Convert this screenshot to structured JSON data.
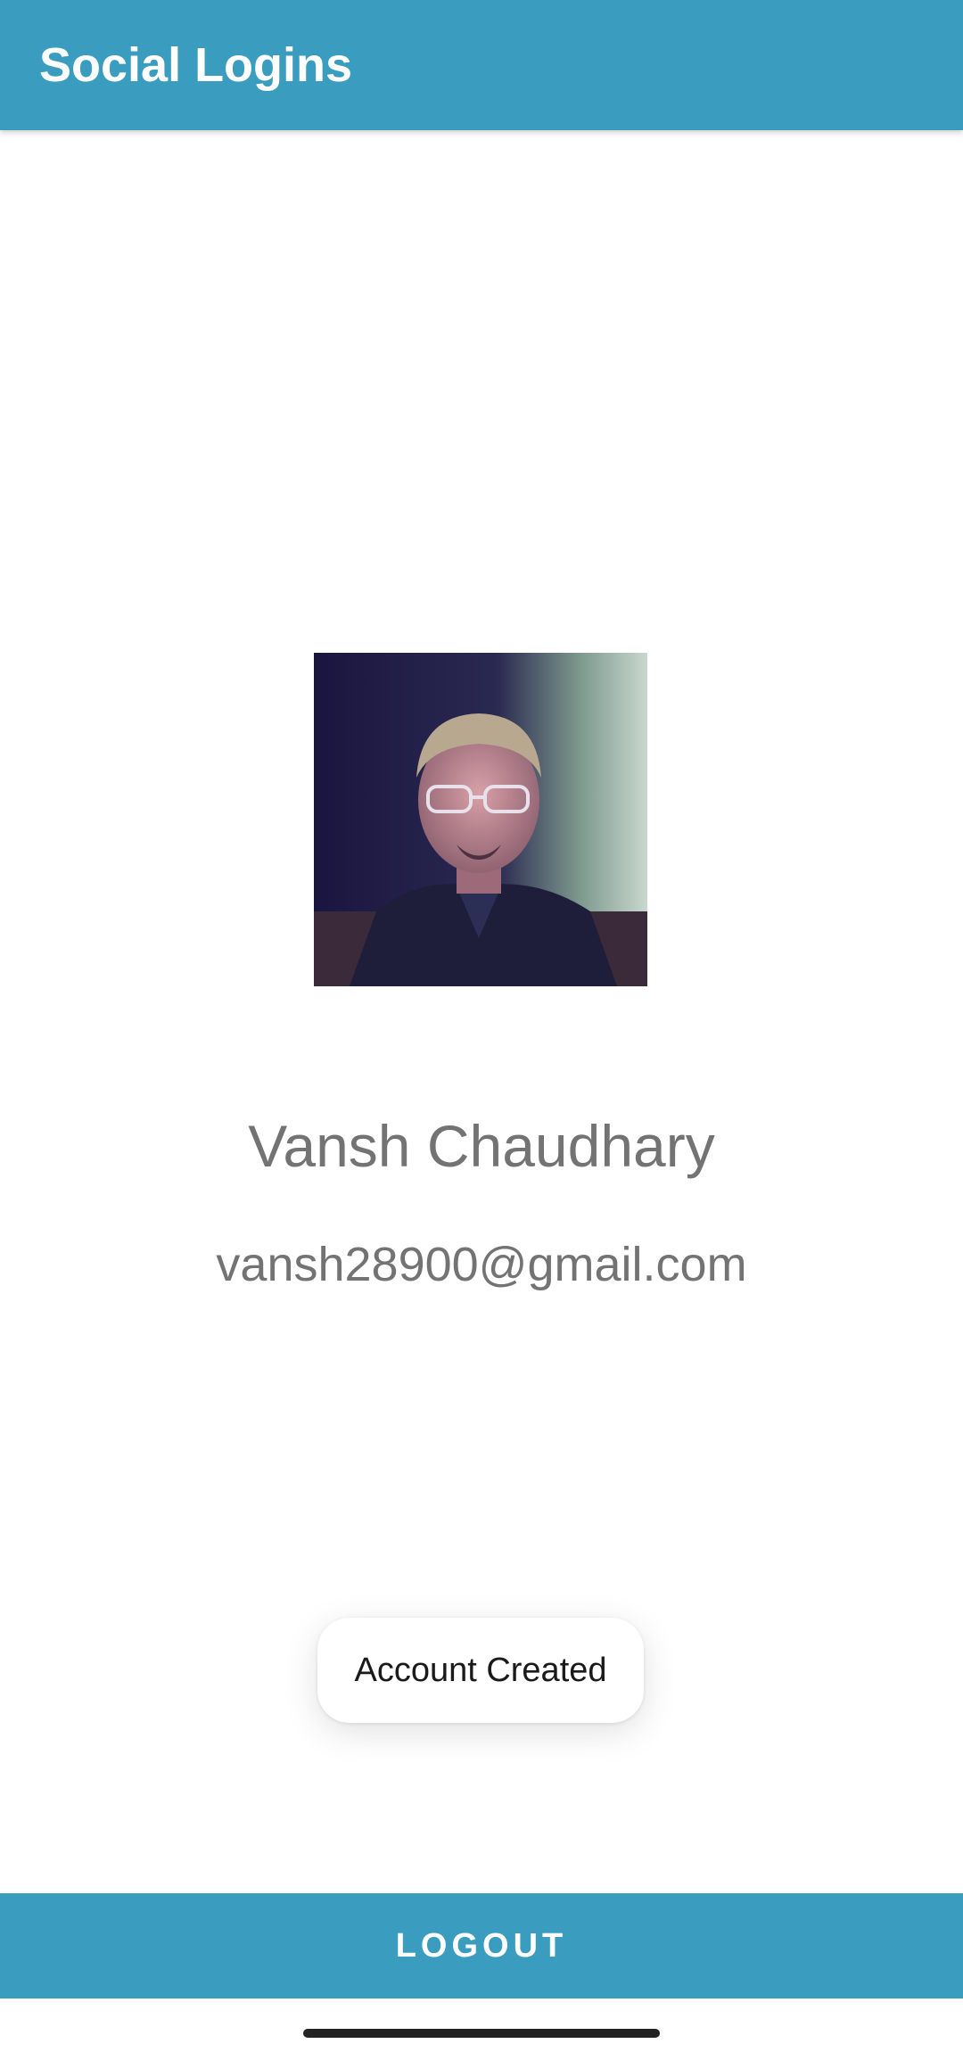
{
  "app_bar": {
    "title": "Social Logins",
    "color": "#3a9dbf"
  },
  "profile": {
    "avatar_icon": "profile-photo",
    "name": "Vansh Chaudhary",
    "email": "vansh28900@gmail.com"
  },
  "toast": {
    "message": "Account Created"
  },
  "footer": {
    "logout_label": "LOGOUT",
    "color": "#3a9dbf"
  },
  "system": {
    "gesture_bar_icon": "home-gesture-handle"
  }
}
